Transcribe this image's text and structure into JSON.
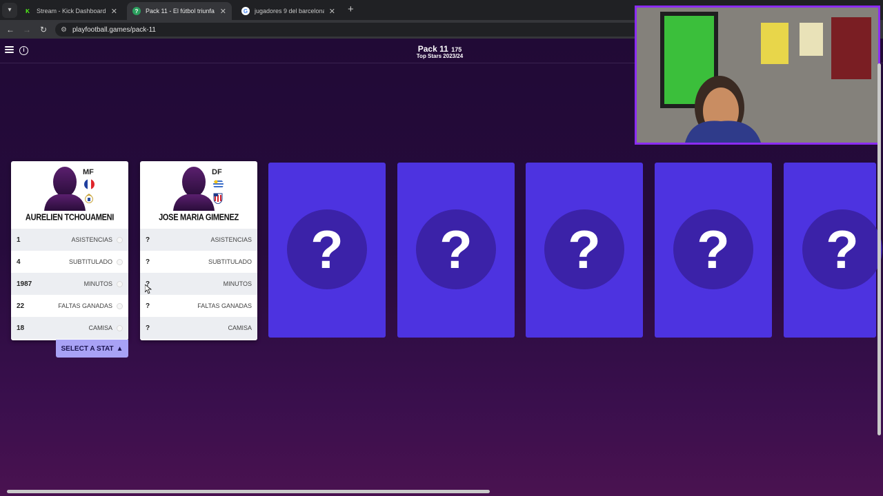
{
  "browser": {
    "tabs": [
      {
        "title": "Stream - Kick Dashboard",
        "favicon": "K",
        "favicon_color": "#53fc18"
      },
      {
        "title": "Pack 11 - El fútbol triunfa sobre",
        "favicon": "?",
        "favicon_color": "#2b9f5e"
      },
      {
        "title": "jugadores 9 del barcelona - Bu",
        "favicon": "G",
        "favicon_color": "#ffffff"
      }
    ],
    "url": "playfootball.games/pack-11"
  },
  "header": {
    "pack_name": "Pack 11",
    "pack_count": "175",
    "subtitle": "Top Stars 2023/24"
  },
  "cards": [
    {
      "position": "MF",
      "name": "AURELIEN TCHOUAMENI",
      "flag": "france",
      "club": "real-madrid",
      "stats": [
        {
          "value": "1",
          "label": "ASISTENCIAS"
        },
        {
          "value": "4",
          "label": "SUBTITULADO"
        },
        {
          "value": "1987",
          "label": "MINUTOS"
        },
        {
          "value": "22",
          "label": "FALTAS GANADAS"
        },
        {
          "value": "18",
          "label": "CAMISA"
        }
      ]
    },
    {
      "position": "DF",
      "name": "JOSE MARIA GIMENEZ",
      "flag": "uruguay",
      "club": "atletico-madrid",
      "stats": [
        {
          "value": "?",
          "label": "ASISTENCIAS"
        },
        {
          "value": "?",
          "label": "SUBTITULADO"
        },
        {
          "value": "?",
          "label": "MINUTOS"
        },
        {
          "value": "?",
          "label": "FALTAS GANADAS"
        },
        {
          "value": "?",
          "label": "CAMISA"
        }
      ]
    }
  ],
  "select_stat_label": "SELECT A STAT",
  "mystery_cards": [
    "?",
    "?",
    "?",
    "?",
    "?"
  ],
  "colors": {
    "mystery_card": "#4d33e0",
    "mystery_circle": "#3b22a8",
    "select_button": "#a8a2f5",
    "webcam_border": "#8b2cf5"
  }
}
